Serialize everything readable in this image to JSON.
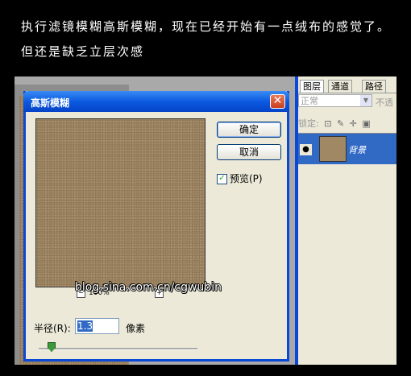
{
  "caption": {
    "line1": "执行滤镜模糊高斯模糊，现在已经开始有一点绒布的感觉了。",
    "line2": "但还是缺乏立层次感"
  },
  "dialog": {
    "title": "高斯模糊",
    "close": "✕",
    "ok_label": "确定",
    "cancel_label": "取消",
    "preview_check": "✓",
    "preview_label": "预览(P)",
    "zoom_minus": "−",
    "zoom_plus": "+",
    "zoom_value": "100%",
    "radius_label": "半径(R):",
    "radius_value": "1.3",
    "radius_unit": "像素"
  },
  "watermark": "blog.sina.com.cn/cgwubin",
  "layers_panel": {
    "tabs": [
      "图层",
      "通道",
      "路径"
    ],
    "blend_mode": "正常",
    "opacity_label": "不透",
    "lock_label": "锁定:",
    "layer_name": "背景"
  },
  "colors": {
    "accent": "#0a48d8",
    "selection": "#316ac5",
    "texture": "#a08865"
  }
}
